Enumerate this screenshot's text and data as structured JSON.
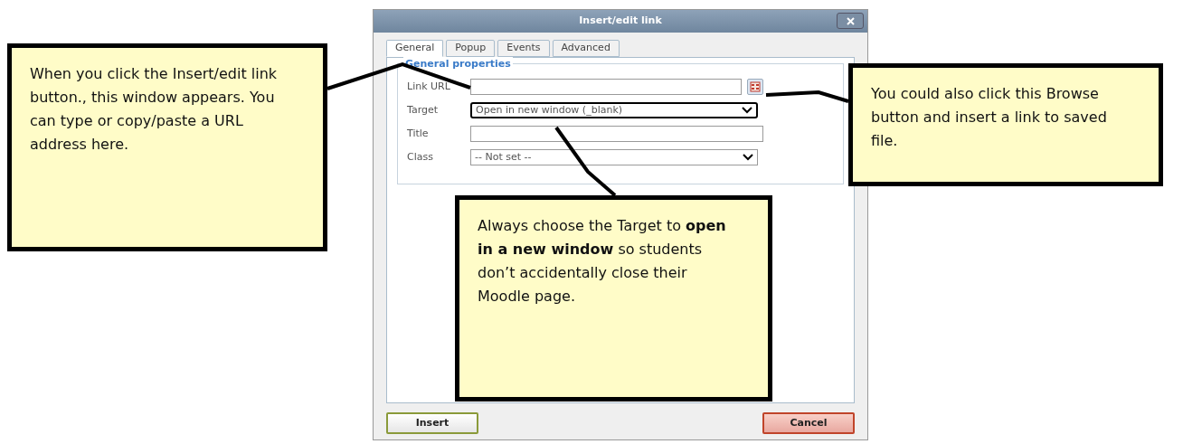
{
  "dialog": {
    "title": "Insert/edit link",
    "tabs": [
      {
        "label": "General",
        "selected": true
      },
      {
        "label": "Popup",
        "selected": false
      },
      {
        "label": "Events",
        "selected": false
      },
      {
        "label": "Advanced",
        "selected": false
      }
    ],
    "section_title": "General properties",
    "fields": [
      {
        "kind": "text",
        "label": "Link URL",
        "browse": true,
        "highlighted": false
      },
      {
        "kind": "select",
        "label": "Target",
        "value": "Open in new window (_blank)",
        "highlighted": true
      },
      {
        "kind": "text",
        "label": "Title",
        "highlighted": false
      },
      {
        "kind": "select",
        "label": "Class",
        "value": "-- Not set --",
        "highlighted": false
      }
    ],
    "buttons": [
      {
        "label": "Insert",
        "kind": "confirm"
      },
      {
        "label": "Cancel",
        "kind": "cancel"
      }
    ]
  },
  "callouts": [
    {
      "text": "When you click the Insert/edit link button., this window appears. You can type or copy/paste a URL address here."
    },
    {
      "text": "You could also click this Browse button and insert a link to saved file."
    },
    {
      "text": "Always choose the Target to **open in a new window** so students don’t accidentally close their Moodle page."
    }
  ]
}
